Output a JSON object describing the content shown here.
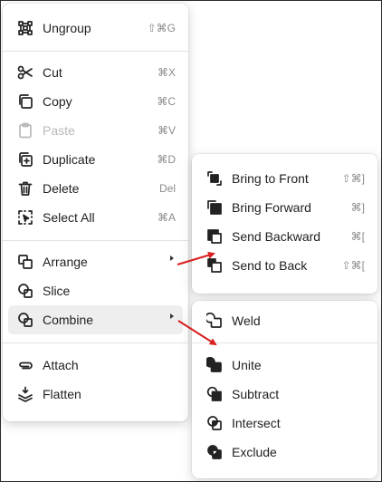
{
  "main_menu": {
    "items": [
      {
        "label": "Ungroup",
        "shortcut": "⇧⌘G",
        "icon": "ungroup-icon"
      },
      {
        "label": "Cut",
        "shortcut": "⌘X",
        "icon": "scissors-icon"
      },
      {
        "label": "Copy",
        "shortcut": "⌘C",
        "icon": "copy-icon"
      },
      {
        "label": "Paste",
        "shortcut": "⌘V",
        "icon": "clipboard-icon",
        "disabled": true
      },
      {
        "label": "Duplicate",
        "shortcut": "⌘D",
        "icon": "duplicate-icon"
      },
      {
        "label": "Delete",
        "shortcut": "Del",
        "icon": "trash-icon"
      },
      {
        "label": "Select All",
        "shortcut": "⌘A",
        "icon": "select-all-icon"
      },
      {
        "label": "Arrange",
        "icon": "arrange-icon",
        "submenu": true
      },
      {
        "label": "Slice",
        "icon": "slice-icon"
      },
      {
        "label": "Combine",
        "icon": "combine-icon",
        "submenu": true,
        "highlighted": true
      },
      {
        "label": "Attach",
        "icon": "paperclip-icon"
      },
      {
        "label": "Flatten",
        "icon": "flatten-icon"
      }
    ]
  },
  "arrange_menu": {
    "items": [
      {
        "label": "Bring to Front",
        "shortcut": "⇧⌘]",
        "icon": "bring-to-front-icon"
      },
      {
        "label": "Bring Forward",
        "shortcut": "⌘]",
        "icon": "bring-forward-icon"
      },
      {
        "label": "Send Backward",
        "shortcut": "⌘[",
        "icon": "send-backward-icon"
      },
      {
        "label": "Send to Back",
        "shortcut": "⇧⌘[",
        "icon": "send-to-back-icon"
      }
    ]
  },
  "combine_menu": {
    "items": [
      {
        "label": "Weld",
        "icon": "weld-icon"
      },
      {
        "label": "Unite",
        "icon": "unite-icon"
      },
      {
        "label": "Subtract",
        "icon": "subtract-icon"
      },
      {
        "label": "Intersect",
        "icon": "intersect-icon"
      },
      {
        "label": "Exclude",
        "icon": "exclude-icon"
      }
    ]
  },
  "colors": {
    "annotation_arrow": "#d81f1f",
    "highlight": "#eeeeee",
    "shortcut_text": "#8a8a8a",
    "disabled_text": "#b9b9b9"
  }
}
